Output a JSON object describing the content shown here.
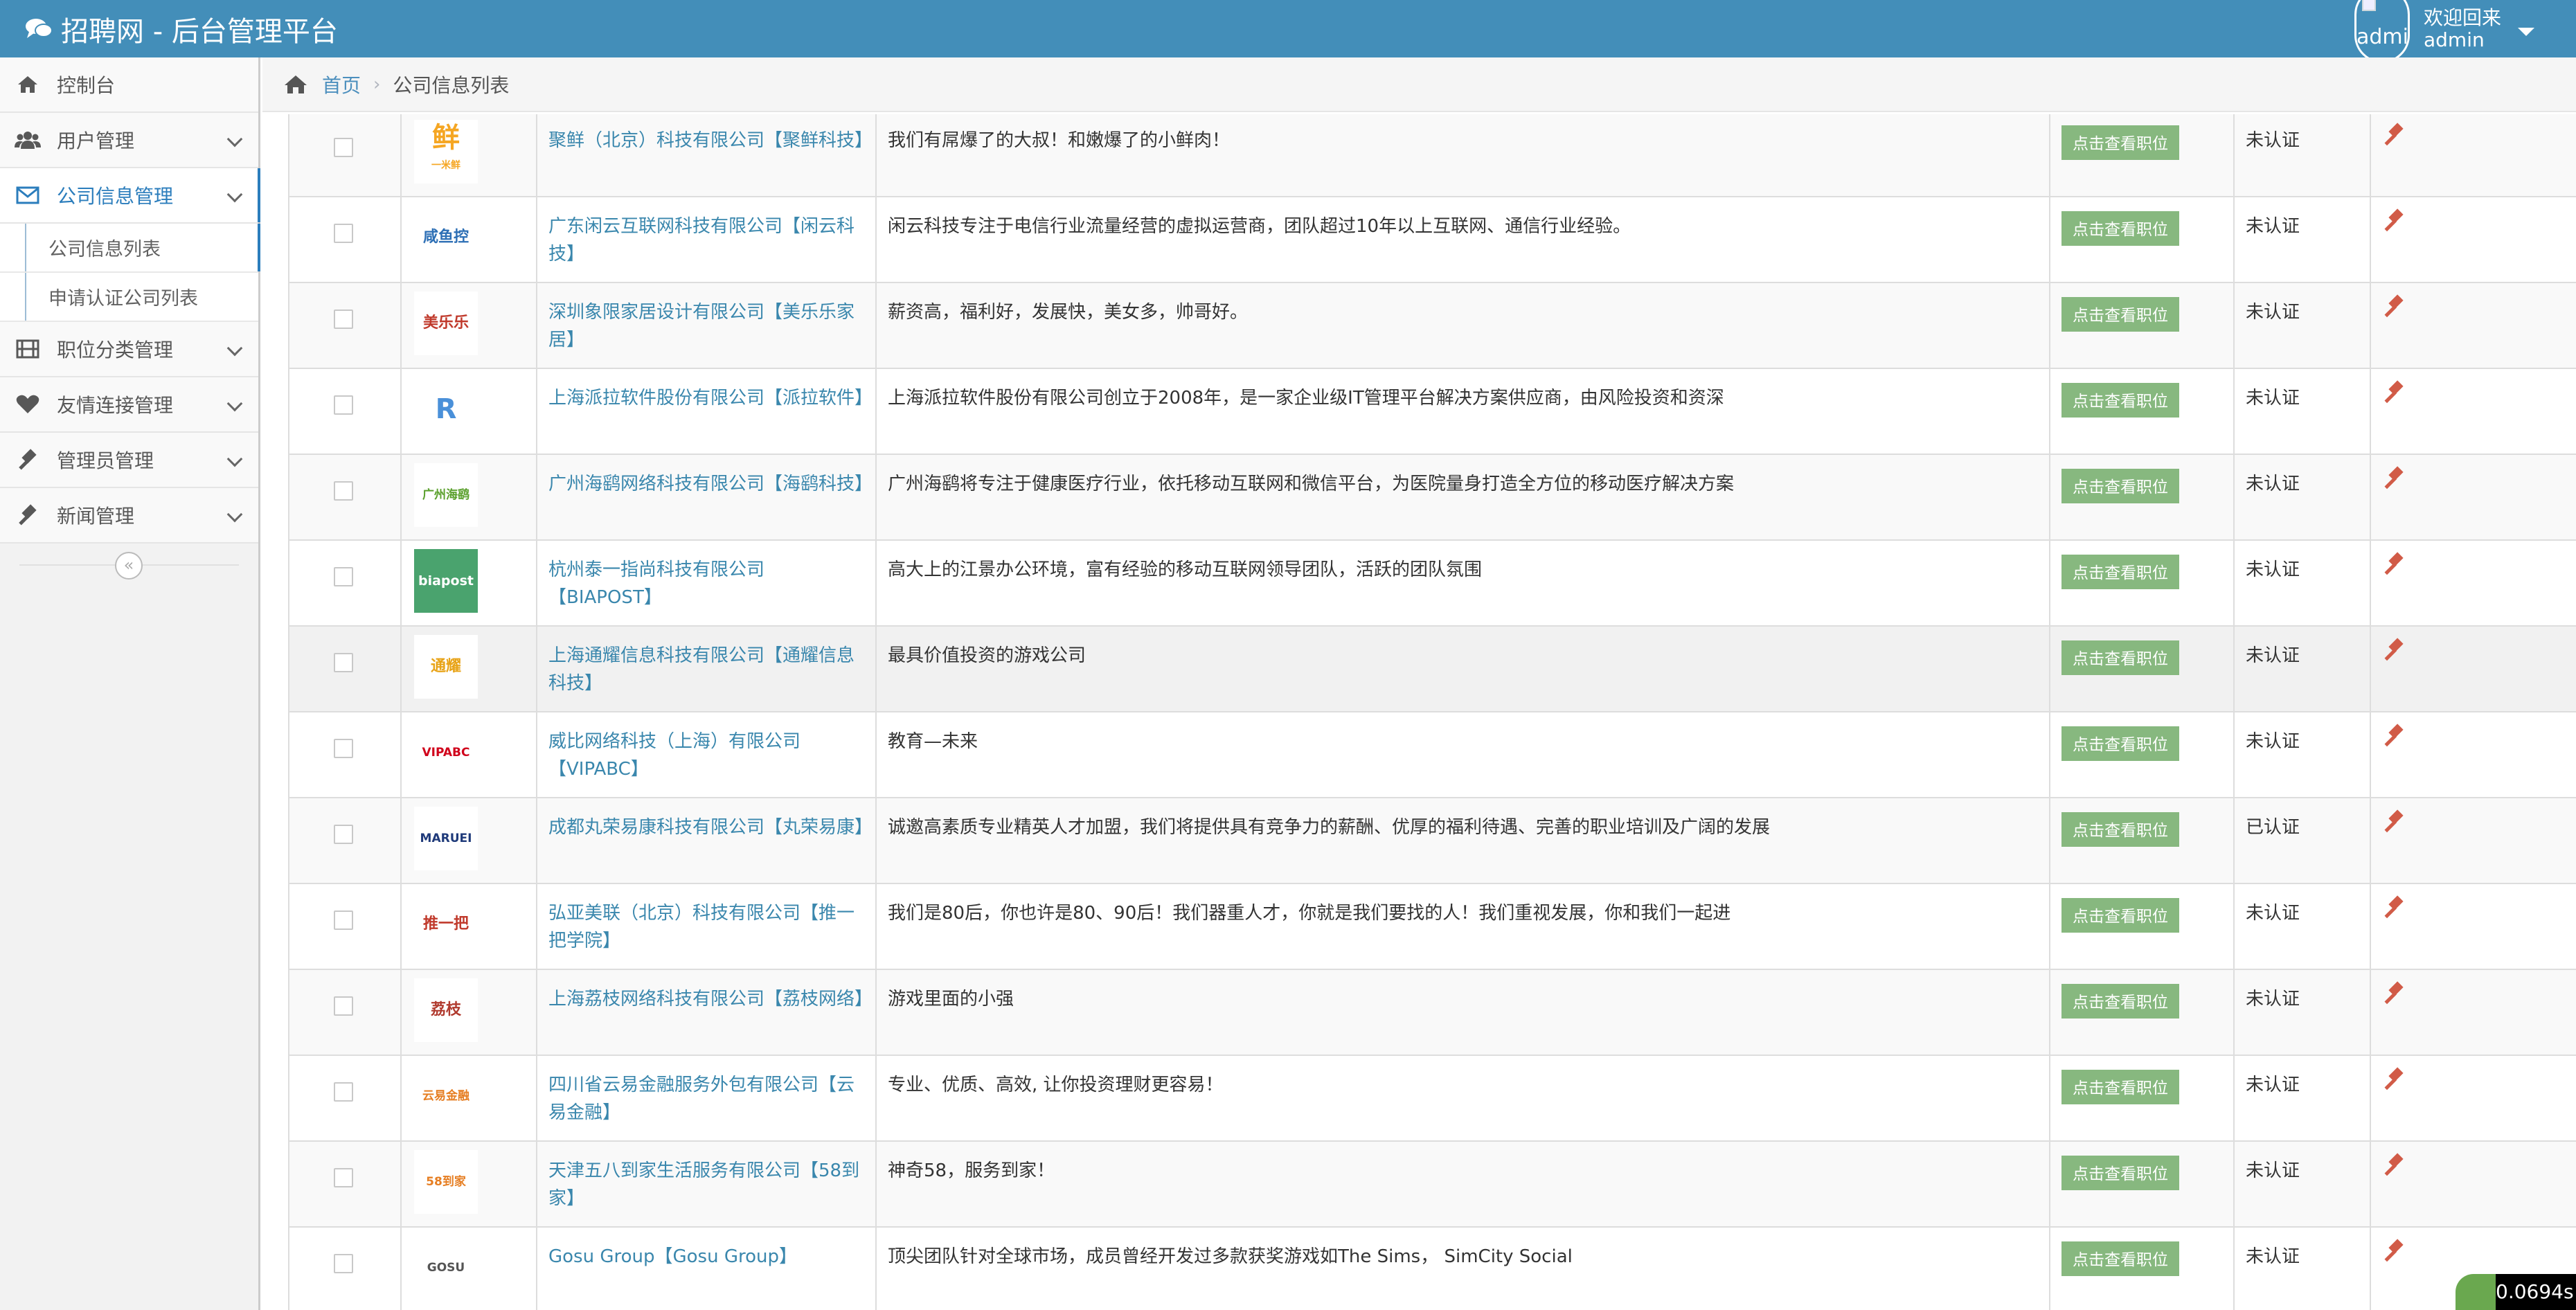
{
  "app": {
    "title": "招聘网 - 后台管理平台"
  },
  "user": {
    "welcome": "欢迎回来",
    "name": "admin",
    "avatar_alt": "admin"
  },
  "sidebar": {
    "items": [
      {
        "label": "控制台",
        "icon": "dashboard-icon"
      },
      {
        "label": "用户管理",
        "icon": "users-icon"
      },
      {
        "label": "公司信息管理",
        "icon": "envelope-icon"
      },
      {
        "label": "职位分类管理",
        "icon": "film-icon"
      },
      {
        "label": "友情连接管理",
        "icon": "heart-icon"
      },
      {
        "label": "管理员管理",
        "icon": "gavel-icon"
      },
      {
        "label": "新闻管理",
        "icon": "gavel-icon"
      }
    ],
    "subitems": [
      "公司信息列表",
      "申请认证公司列表"
    ],
    "collapse_symbol": "«"
  },
  "breadcrumb": {
    "home": "首页",
    "current": "公司信息列表"
  },
  "table": {
    "button_label": "点击查看职位",
    "rows": [
      {
        "name": "聚鲜（北京）科技有限公司【聚鲜科技】",
        "desc": "我们有屌爆了的大叔！和嫩爆了的小鲜肉！",
        "status": "未认证",
        "logo": "鲜",
        "logo_sub": "一米鲜",
        "logo_color": "#f5a623"
      },
      {
        "name": "广东闲云互联网科技有限公司【闲云科技】",
        "desc": "闲云科技专注于电信行业流量经营的虚拟运营商，团队超过10年以上互联网、通信行业经验。",
        "status": "未认证",
        "logo": "咸鱼控",
        "logo_color": "#2d6fb5"
      },
      {
        "name": "深圳象限家居设计有限公司【美乐乐家居】",
        "desc": "薪资高，福利好，发展快，美女多，帅哥好。",
        "status": "未认证",
        "logo": "美乐乐",
        "logo_color": "#c0392b"
      },
      {
        "name": "上海派拉软件股份有限公司【派拉软件】",
        "desc": "上海派拉软件股份有限公司创立于2008年，是一家企业级IT管理平台解决方案供应商，由风险投资和资深",
        "status": "未认证",
        "logo": "R",
        "logo_color": "#4a90d9"
      },
      {
        "name": "广州海鹞网络科技有限公司【海鹞科技】",
        "desc": "广州海鹞将专注于健康医疗行业，依托移动互联网和微信平台，为医院量身打造全方位的移动医疗解决方案",
        "status": "未认证",
        "logo": "广州海鹞",
        "logo_color": "#5aa02c"
      },
      {
        "name": "杭州泰一指尚科技有限公司【BIAPOST】",
        "desc": "高大上的江景办公环境，富有经验的移动互联网领导团队，活跃的团队氛围",
        "status": "未认证",
        "logo": "biapost",
        "logo_color": "#4aa36e"
      },
      {
        "name": "上海通耀信息科技有限公司【通耀信息科技】",
        "desc": "最具价值投资的游戏公司",
        "status": "未认证",
        "logo": "通耀",
        "logo_color": "#e8a317"
      },
      {
        "name": "威比网络科技（上海）有限公司【VIPABC】",
        "desc": "教育—未来",
        "status": "未认证",
        "logo": "VIPABC",
        "logo_color": "#d0021b"
      },
      {
        "name": "成都丸荣易康科技有限公司【丸荣易康】",
        "desc": "诚邀高素质专业精英人才加盟，我们将提供具有竞争力的薪酬、优厚的福利待遇、完善的职业培训及广阔的发展",
        "status": "已认证",
        "logo": "MARUEI",
        "logo_color": "#1f3a7a"
      },
      {
        "name": "弘亚美联（北京）科技有限公司【推一把学院】",
        "desc": "我们是80后，你也许是80、90后！我们器重人才，你就是我们要找的人！我们重视发展，你和我们一起进",
        "status": "未认证",
        "logo": "推一把",
        "logo_color": "#c0392b"
      },
      {
        "name": "上海荔枝网络科技有限公司【荔枝网络】",
        "desc": "游戏里面的小强",
        "status": "未认证",
        "logo": "荔枝",
        "logo_color": "#b03a2e"
      },
      {
        "name": "四川省云易金融服务外包有限公司【云易金融】",
        "desc": "专业、优质、高效, 让你投资理财更容易！",
        "status": "未认证",
        "logo": "云易金融",
        "logo_color": "#e67e22"
      },
      {
        "name": "天津五八到家生活服务有限公司【58到家】",
        "desc": "神奇58，服务到家！",
        "status": "未认证",
        "logo": "58到家",
        "logo_color": "#e67e22"
      },
      {
        "name": "Gosu Group【Gosu Group】",
        "desc": "顶尖团队针对全球市场，成员曾经开发过多款获奖游戏如The Sims， SimCity Social",
        "status": "未认证",
        "logo": "GOSU",
        "logo_color": "#555555"
      }
    ]
  },
  "timer": "0.0694s",
  "colors": {
    "navbar": "#438eb9",
    "accent": "#2b7dbc",
    "button": "#87b87f",
    "link": "#3a87ad",
    "gavel": "#d15b47"
  }
}
